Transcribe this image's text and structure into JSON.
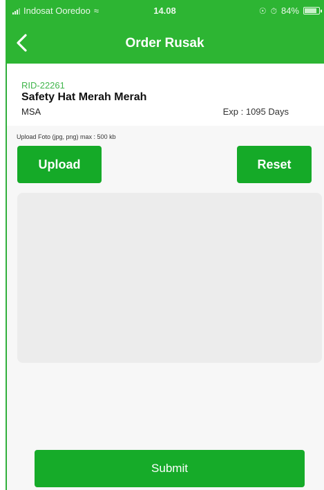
{
  "status_bar": {
    "carrier": "Indosat Ooredoo",
    "time": "14.08",
    "battery": "84%",
    "battery_level": 0.84,
    "icons": [
      "signal-icon",
      "wifi-icon",
      "location-icon",
      "alarm-icon",
      "battery-icon"
    ]
  },
  "nav": {
    "title": "Order Rusak",
    "back_icon": "chevron-left-icon"
  },
  "product": {
    "rid": "RID-22261",
    "name": "Safety Hat Merah Merah",
    "brand": "MSA",
    "exp": "Exp : 1095 Days"
  },
  "upload": {
    "hint": "Upload Foto (jpg, png) max : 500 kb",
    "upload_label": "Upload",
    "reset_label": "Reset"
  },
  "submit_label": "Submit",
  "colors": {
    "header": "#2db533",
    "button": "#15aa28",
    "rid_text": "#3fb54a",
    "photo_area": "#ececec"
  }
}
